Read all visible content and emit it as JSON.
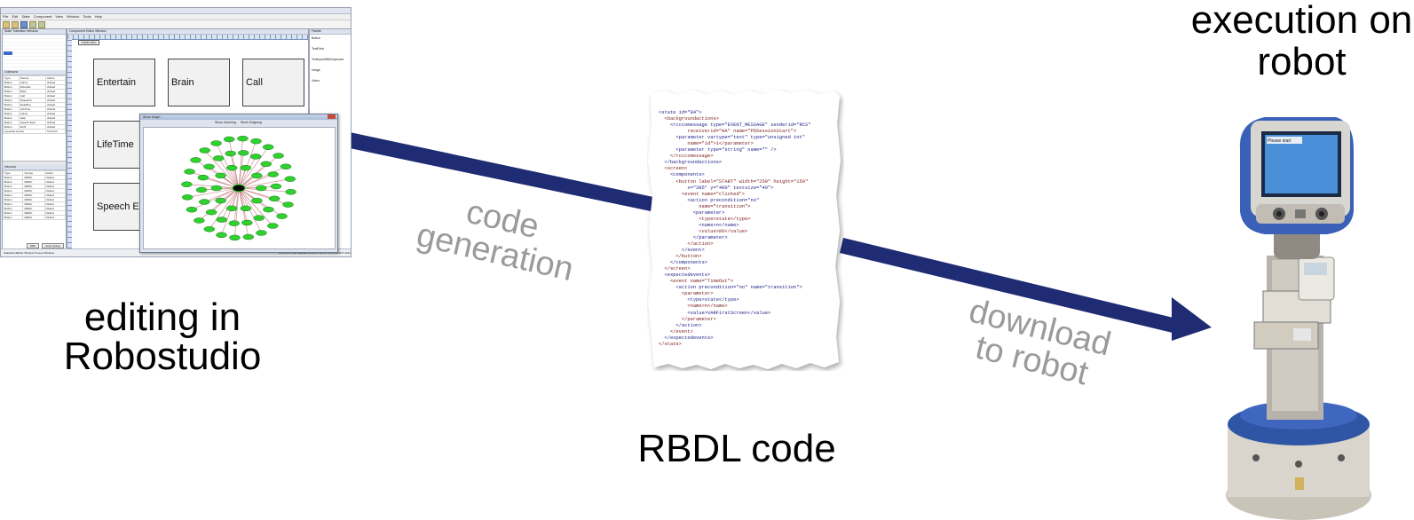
{
  "captions": {
    "editing": "editing in Robostudio",
    "rbdl": "RBDL code",
    "execution": "execution on robot"
  },
  "arrows": {
    "code_generation": "code generation",
    "download_to_robot": "download to robot",
    "color": "#1f2b73",
    "label_color": "#9a9a9a"
  },
  "screenshot": {
    "menu": [
      "File",
      "Edit",
      "State",
      "Component",
      "View",
      "Window",
      "Tools",
      "Help"
    ],
    "left_title": "State Transition Window",
    "mid_title": "Component Editor Window",
    "right_title": "Palette",
    "state_tab": "Initialization",
    "palette_items": [
      "Button",
      "TextField",
      "TextInputWithKeyboard",
      "Image",
      "Video"
    ],
    "outbound_label": "Outbound",
    "outbound_headers": [
      "Type",
      "Source",
      "Action"
    ],
    "outbound_rows": [
      [
        "Button",
        "Admin",
        "clicked"
      ],
      [
        "Button",
        "Entertain",
        "clicked"
      ],
      [
        "Button",
        "Brain",
        "clicked"
      ],
      [
        "Button",
        "Call",
        "clicked"
      ],
      [
        "Button",
        "Research",
        "clicked"
      ],
      [
        "Button",
        "Deadline",
        "clicked"
      ],
      [
        "Button",
        "LifeTime",
        "clicked"
      ],
      [
        "Button",
        "Admin",
        "clicked"
      ],
      [
        "Button",
        "Help",
        "clicked"
      ],
      [
        "Button",
        "Speech Eval",
        "clicked"
      ],
      [
        "Button",
        "EXIT",
        "clicked"
      ]
    ],
    "expected_events": "expected events",
    "expected_action": "TimeOut",
    "inbound_label": "Inbound",
    "inbound_rows": [
      [
        "Button",
        "MENU",
        "clicked"
      ],
      [
        "Button",
        "MENU",
        "clicked"
      ],
      [
        "Button",
        "MENU",
        "clicked"
      ],
      [
        "Button",
        "MENU",
        "clicked"
      ],
      [
        "Button",
        "MENU",
        "clicked"
      ],
      [
        "Button",
        "MENU",
        "clicked"
      ],
      [
        "Button",
        "MENU",
        "clicked"
      ],
      [
        "Button",
        "MENU",
        "clicked"
      ],
      [
        "Button",
        "MENU",
        "clicked"
      ],
      [
        "Button",
        "MENU",
        "clicked"
      ]
    ],
    "components": [
      "Entertain",
      "Brain",
      "Call",
      "LifeTime",
      "Speech Ev"
    ],
    "graph_window_title": "Show Graph",
    "graph_options": [
      "Show Incoming",
      "Show Outgoing"
    ],
    "bottom_buttons": [
      "RBD",
      "Show States"
    ],
    "status_left": "StateEventEditor Window   Timeout Window",
    "status_right": "2012-08-15 sec elapsed since Fri Jun 15 13:41:56 EDT 2012"
  },
  "rbdl_lines": [
    "<state id=\"84\">",
    "  <backgroundactions>",
    "    <rcccomessage type=\"EVENT_MESSAGE\" senderid=\"RCS\"",
    "          receiverid=\"HA\" name=\"PDSessionStart\">",
    "      <parameter vartype=\"text\" type=\"unsigned int\"",
    "          name=\"id\">1</parameter>",
    "      <parameter type=\"string\" name=\"\" />",
    "    </rcccomessage>",
    "  </backgroundactions>",
    "  <screen>",
    "    <components>",
    "      <button label=\"START\" width=\"250\" height=\"150\"",
    "          x=\"385\" y=\"400\" textsize=\"40\">",
    "        <event name=\"clicked\">",
    "          <action precondition=\"no\"",
    "              name=\"transition\">",
    "            <parameter>",
    "              <type>state</type>",
    "              <name>n</name>",
    "              <value>86</value>",
    "            </parameter>",
    "          </action>",
    "        </event>",
    "      </button>",
    "    </components>",
    "  </screen>",
    "  <expectedevents>",
    "    <event name=\"TimeOut\">",
    "      <action precondition=\"no\" name=\"transition\">",
    "        <parameter>",
    "          <type>state</type>",
    "          <name>n</name>",
    "          <value>VARFirstScreen</value>",
    "        </parameter>",
    "      </action>",
    "    </event>",
    "  </expectedevents>",
    "</state>"
  ],
  "robot": {
    "screen_text": "Please start"
  }
}
